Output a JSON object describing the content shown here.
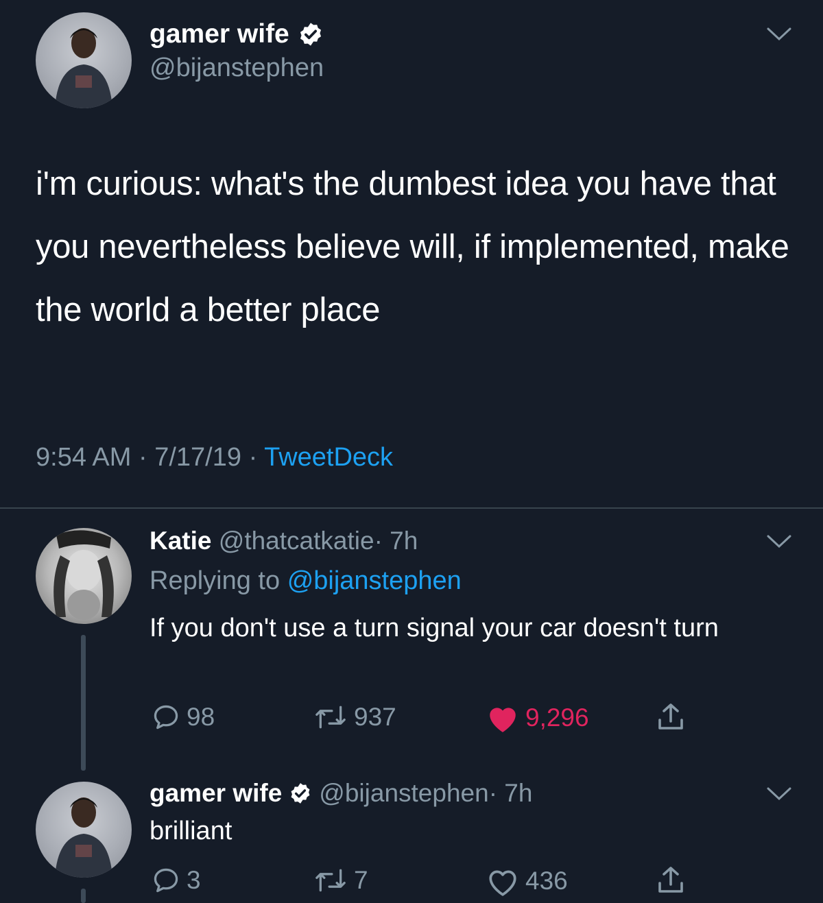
{
  "main_tweet": {
    "display_name": "gamer wife",
    "handle": "@bijanstephen",
    "text": "i'm curious: what's the dumbest idea you have that you nevertheless believe will, if implemented, make the world a better place",
    "time": "9:54 AM",
    "date": "7/17/19",
    "separator": "·",
    "source": "TweetDeck"
  },
  "replies": [
    {
      "display_name": "Katie",
      "handle": "@thatcatkatie",
      "age": "· 7h",
      "replying_prefix": "Replying to",
      "replying_to": "@bijanstephen",
      "text": "If you don't use a turn signal your car doesn't turn",
      "replies_count": "98",
      "retweets_count": "937",
      "likes_count": "9,296",
      "liked": true
    },
    {
      "display_name": "gamer wife",
      "handle": "@bijanstephen",
      "age": "· 7h",
      "text": "brilliant",
      "replies_count": "3",
      "retweets_count": "7",
      "likes_count": "436",
      "liked": false
    }
  ],
  "colors": {
    "background": "#151c28",
    "secondary_text": "#8899a6",
    "link": "#1da1f2",
    "like": "#e0245e",
    "divider": "#38444d"
  }
}
